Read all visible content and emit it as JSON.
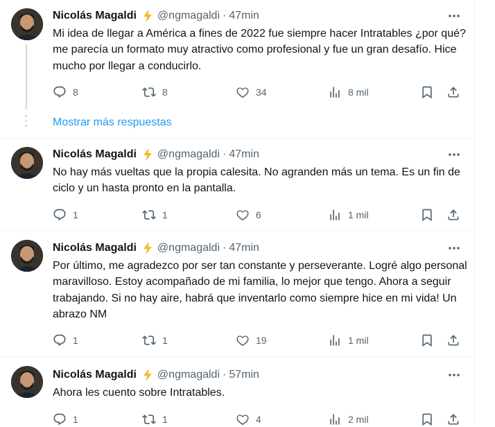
{
  "colors": {
    "accent": "#1d9bf0",
    "text": "#0f1419",
    "secondary": "#536471",
    "badge": "#f7b928"
  },
  "show_more_label": "Mostrar más respuestas",
  "tweets": [
    {
      "name": "Nicolás Magaldi",
      "handle": "@ngmagaldi",
      "sep": "·",
      "time": "47min",
      "text": "Mi idea de llegar a América a fines de 2022 fue siempre hacer Intratables ¿por qué? me parecía un formato muy atractivo como profesional  y fue un gran desafío. Hice mucho por llegar a conducirlo.",
      "replies": "8",
      "retweets": "8",
      "likes": "34",
      "views": "8 mil"
    },
    {
      "name": "Nicolás Magaldi",
      "handle": "@ngmagaldi",
      "sep": "·",
      "time": "47min",
      "text": "No hay más vueltas que la propia calesita. No agranden más un tema. Es un fin de ciclo y un hasta pronto en la pantalla.",
      "replies": "1",
      "retweets": "1",
      "likes": "6",
      "views": "1 mil"
    },
    {
      "name": "Nicolás Magaldi",
      "handle": "@ngmagaldi",
      "sep": "·",
      "time": "47min",
      "text": "Por último, me agradezco por ser tan constante y perseverante. Logré algo personal maravilloso. Estoy acompañado de mi familia, lo mejor que tengo. Ahora a seguir trabajando. Si no hay aire, habrá que inventarlo como siempre hice en mi vida! Un abrazo NM",
      "replies": "1",
      "retweets": "1",
      "likes": "19",
      "views": "1 mil"
    },
    {
      "name": "Nicolás Magaldi",
      "handle": "@ngmagaldi",
      "sep": "·",
      "time": "57min",
      "text": "Ahora les cuento sobre Intratables.",
      "replies": "1",
      "retweets": "1",
      "likes": "4",
      "views": "2 mil"
    }
  ]
}
